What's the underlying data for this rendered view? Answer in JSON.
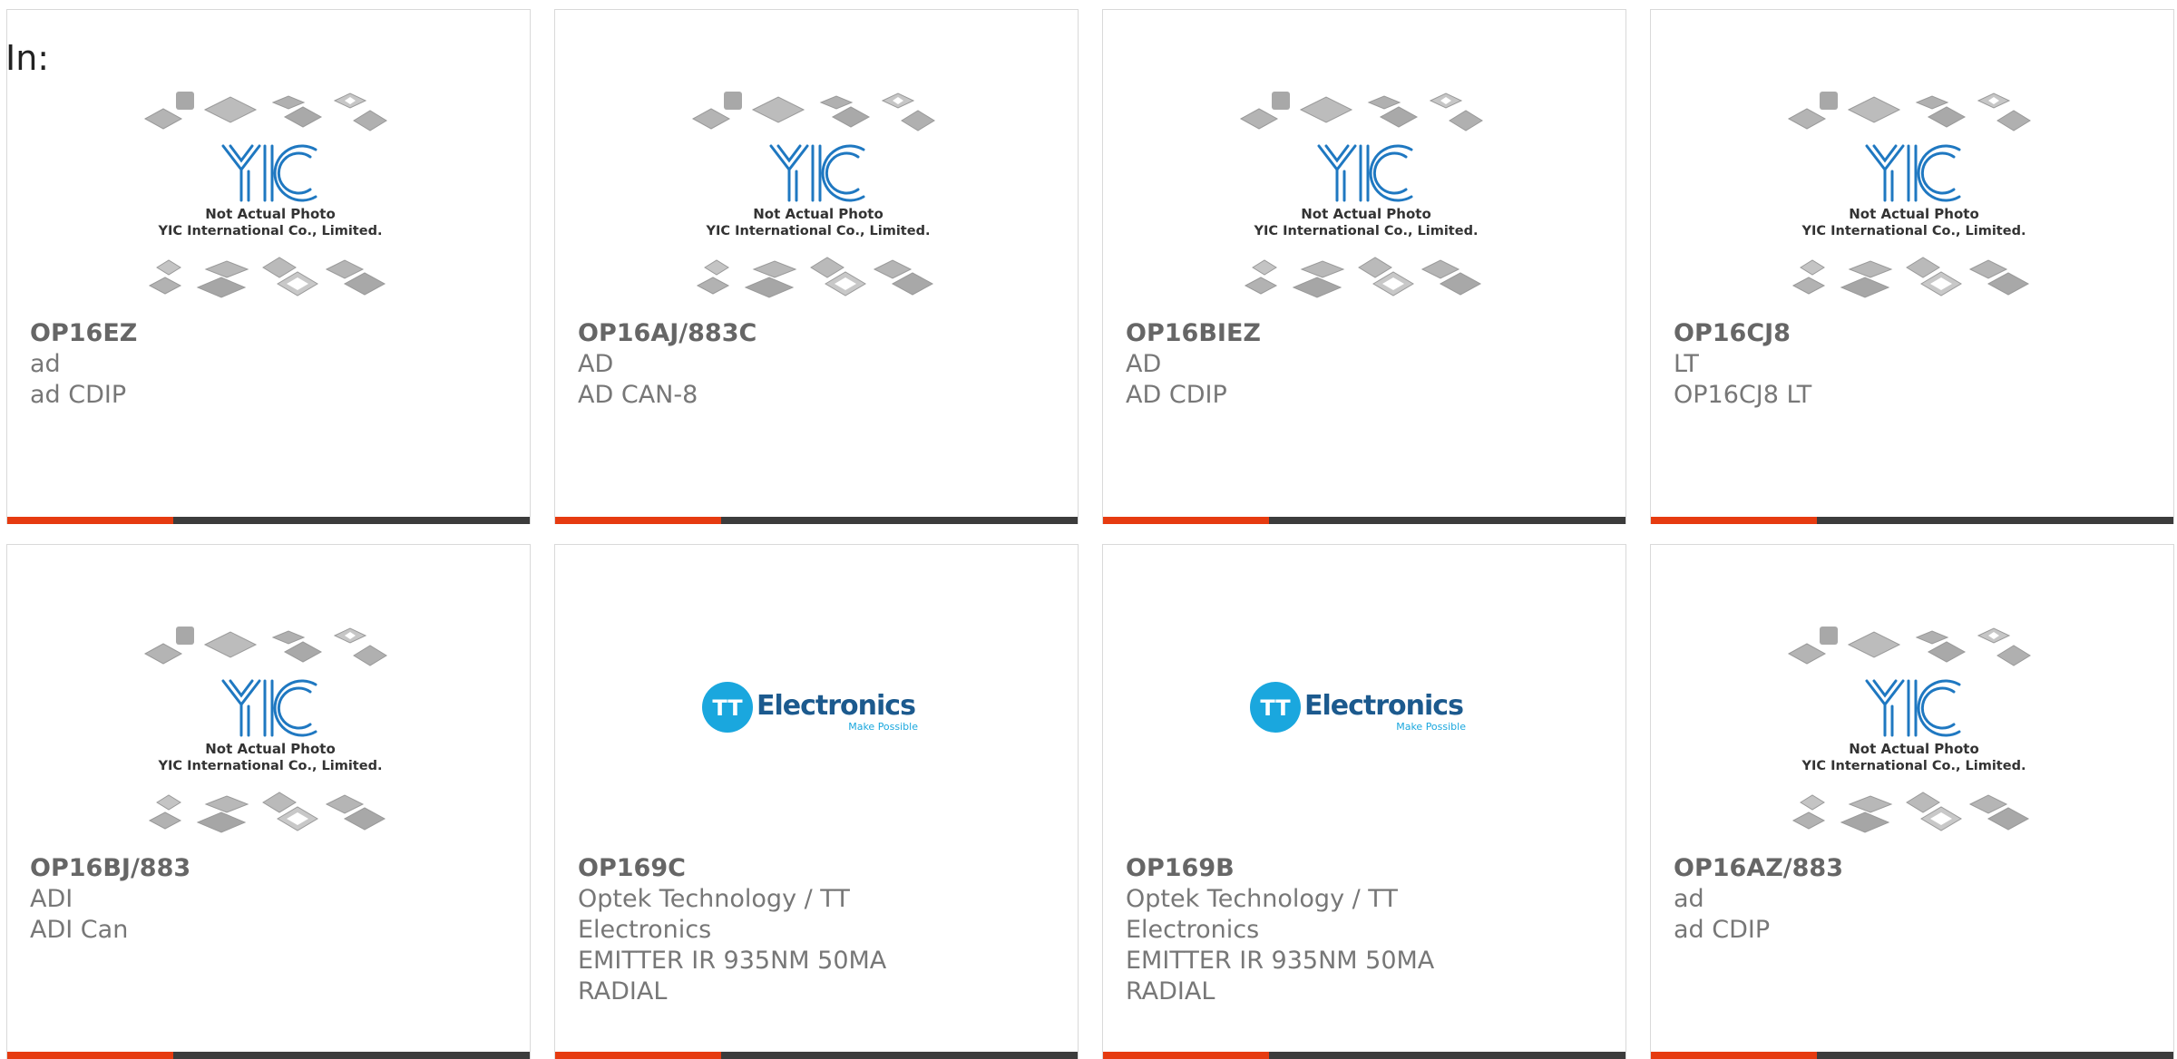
{
  "page": {
    "label": "In:"
  },
  "placeholder_photo": {
    "line1": "Not Actual Photo",
    "line2": "YIC International Co., Limited.",
    "logo_text": "YIC"
  },
  "tt_logo": {
    "badge": "TT",
    "name": "Electronics",
    "tagline": "Make Possible",
    "color": "#1aa7de"
  },
  "colors": {
    "accent": "#e63b10",
    "bar": "#3c3c3c",
    "yic_blue": "#1f78c1"
  },
  "products": [
    {
      "part": "OP16EZ",
      "lines": [
        "ad",
        "ad CDIP"
      ],
      "image": "yic-placeholder"
    },
    {
      "part": "OP16AJ/883C",
      "lines": [
        "AD",
        "AD CAN-8"
      ],
      "image": "yic-placeholder"
    },
    {
      "part": "OP16BIEZ",
      "lines": [
        "AD",
        "AD CDIP"
      ],
      "image": "yic-placeholder"
    },
    {
      "part": "OP16CJ8",
      "lines": [
        "LT",
        "OP16CJ8 LT"
      ],
      "image": "yic-placeholder"
    },
    {
      "part": "OP16BJ/883",
      "lines": [
        "ADI",
        "ADI Can"
      ],
      "image": "yic-placeholder"
    },
    {
      "part": "OP169C",
      "lines": [
        "Optek Technology / TT",
        "Electronics",
        "EMITTER IR 935NM 50MA",
        "RADIAL"
      ],
      "image": "tt-electronics-logo"
    },
    {
      "part": "OP169B",
      "lines": [
        "Optek Technology / TT",
        "Electronics",
        "EMITTER IR 935NM 50MA",
        "RADIAL"
      ],
      "image": "tt-electronics-logo"
    },
    {
      "part": "OP16AZ/883",
      "lines": [
        "ad",
        "ad CDIP"
      ],
      "image": "yic-placeholder"
    }
  ]
}
